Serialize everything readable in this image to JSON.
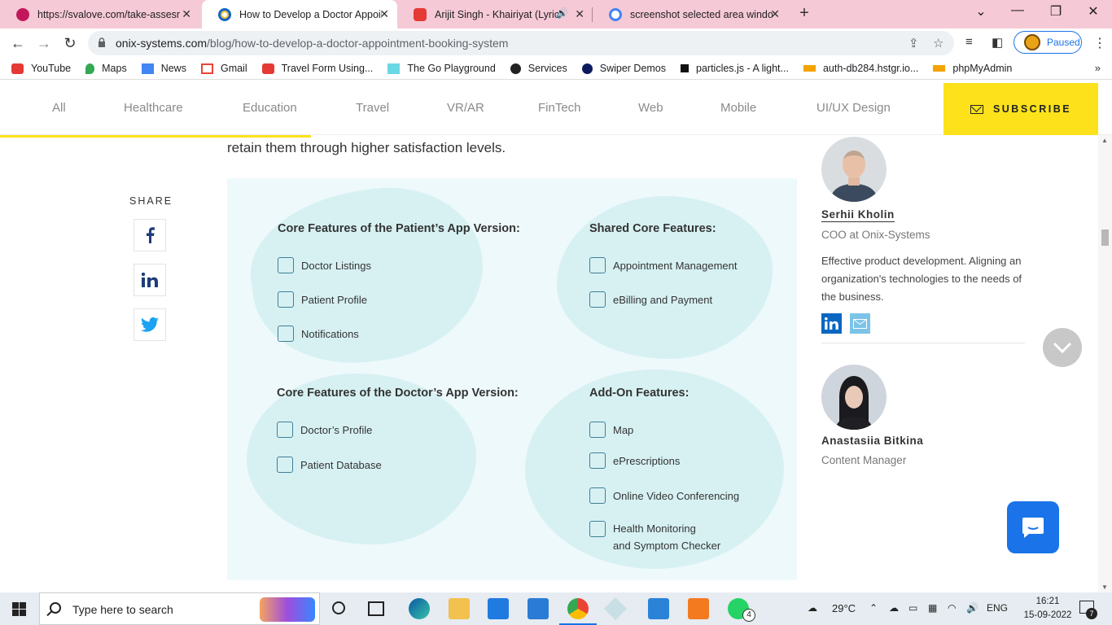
{
  "browser": {
    "tabs": [
      {
        "title": "https://svalove.com/take-assesm",
        "favicon_color": "#c2185b"
      },
      {
        "title": "How to Develop a Doctor Appoin",
        "favicon_color": "#1565c0"
      },
      {
        "title": "Arijit Singh - Khairiyat (Lyrics",
        "favicon_color": "#e53935"
      },
      {
        "title": "screenshot selected area window",
        "favicon_color": "#4285f4"
      }
    ],
    "url_host": "onix-systems.com",
    "url_path": "/blog/how-to-develop-a-doctor-appointment-booking-system",
    "profile_status": "Paused",
    "bookmarks": [
      "YouTube",
      "Maps",
      "News",
      "Gmail",
      "Travel Form Using...",
      "The Go Playground",
      "Services",
      "Swiper Demos",
      "particles.js - A light...",
      "auth-db284.hstgr.io...",
      "phpMyAdmin"
    ]
  },
  "site_nav": {
    "items": [
      "All",
      "Healthcare",
      "Education",
      "Travel",
      "VR/AR",
      "FinTech",
      "Web",
      "Mobile",
      "UI/UX Design"
    ],
    "subscribe_label": "SUBSCRIBE",
    "accent_color": "#fde21b",
    "reading_progress": 0.28
  },
  "article": {
    "lead_text": "retain them through higher satisfaction levels.",
    "share_label": "SHARE"
  },
  "infographic": {
    "patient": {
      "title": "Core Features of the Patient’s App Version:",
      "items": [
        "Doctor Listings",
        "Patient Profile",
        "Notifications"
      ]
    },
    "shared": {
      "title": "Shared Core Features:",
      "items": [
        "Appointment Management",
        "eBilling and Payment"
      ]
    },
    "doctor": {
      "title": "Core Features of the Doctor’s App Version:",
      "items": [
        "Doctor’s Profile",
        "Patient Database"
      ]
    },
    "addon": {
      "title": "Add-On Features:",
      "items": [
        "Map",
        "ePrescriptions",
        "Online Video Conferencing",
        "Health Monitoring",
        "and Symptom Checker"
      ]
    }
  },
  "sidebar": {
    "author1": {
      "name": "Serhii Kholin",
      "role": "COO at Onix-Systems",
      "bio": "Effective product development. Aligning an organization's technologies to the needs of the business."
    },
    "author2": {
      "name": "Anastasiia Bitkina",
      "role": "Content Manager"
    }
  },
  "taskbar": {
    "search_placeholder": "Type here to search",
    "weather": "29°C",
    "language": "ENG",
    "time": "16:21",
    "date": "15-09-2022",
    "whatsapp_badge": "4",
    "notification_count": "7"
  }
}
